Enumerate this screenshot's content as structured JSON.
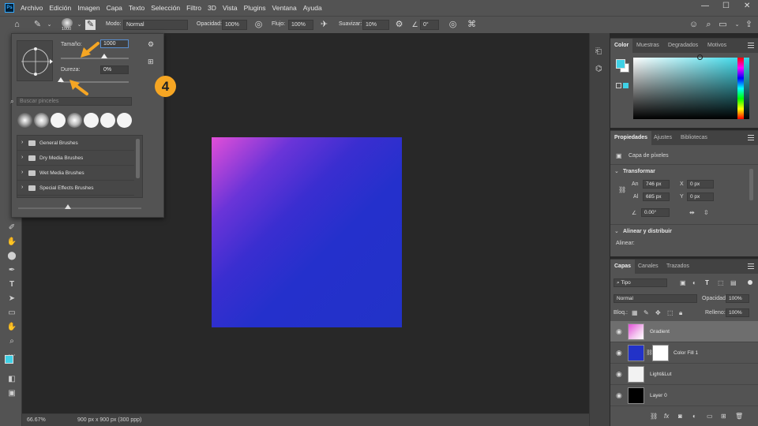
{
  "app": {
    "logo": "Ps"
  },
  "menu": [
    "Archivo",
    "Edición",
    "Imagen",
    "Capa",
    "Texto",
    "Selección",
    "Filtro",
    "3D",
    "Vista",
    "Plugins",
    "Ventana",
    "Ayuda"
  ],
  "options": {
    "brush_size": "1000",
    "mode_label": "Modo:",
    "mode_value": "Normal",
    "opacity_label": "Opacidad:",
    "opacity_value": "100%",
    "flow_label": "Flujo:",
    "flow_value": "100%",
    "smooth_label": "Suavizar:",
    "smooth_value": "10%",
    "angle_value": "0°"
  },
  "brush_popup": {
    "size_label": "Tamaño:",
    "size_value": "1000",
    "size_level": 0.64,
    "hardness_label": "Dureza:",
    "hardness_value": "0%",
    "hardness_level": 0.0,
    "search_placeholder": "Buscar pinceles",
    "folders": [
      "General Brushes",
      "Dry Media Brushes",
      "Wet Media Brushes",
      "Special Effects Brushes"
    ]
  },
  "step_number": "4",
  "status": {
    "zoom": "66.67%",
    "doc_info": "900 px x 900 px (300 ppp)"
  },
  "color_panel": {
    "tabs": [
      "Color",
      "Muestras",
      "Degradados",
      "Motivos"
    ]
  },
  "properties_panel": {
    "tabs": [
      "Propiedades",
      "Ajustes",
      "Bibliotecas"
    ],
    "layer_type": "Capa de píxeles",
    "transform_title": "Transformar",
    "w_label": "An",
    "w_value": "746 px",
    "x_label": "X",
    "x_value": "0 px",
    "h_label": "Al",
    "h_value": "685 px",
    "y_label": "Y",
    "y_value": "0 px",
    "angle_value": "0.00°",
    "align_title": "Alinear y distribuir",
    "align_label": "Alinear:"
  },
  "layers_panel": {
    "tabs": [
      "Capas",
      "Canales",
      "Trazados"
    ],
    "filter_label": "Tipo",
    "blend_mode": "Normal",
    "opacity_label": "Opacidad:",
    "opacity_value": "100%",
    "lock_label": "Bloq.:",
    "fill_label": "Relleno:",
    "fill_value": "100%",
    "layers": [
      "Gradient",
      "Color Fill 1",
      "Light&Lut",
      "Layer 0"
    ]
  },
  "colors": {
    "accent_orange": "#f6a623",
    "foreground": "#3fd1e6",
    "fill_layer": "#2232c8"
  }
}
